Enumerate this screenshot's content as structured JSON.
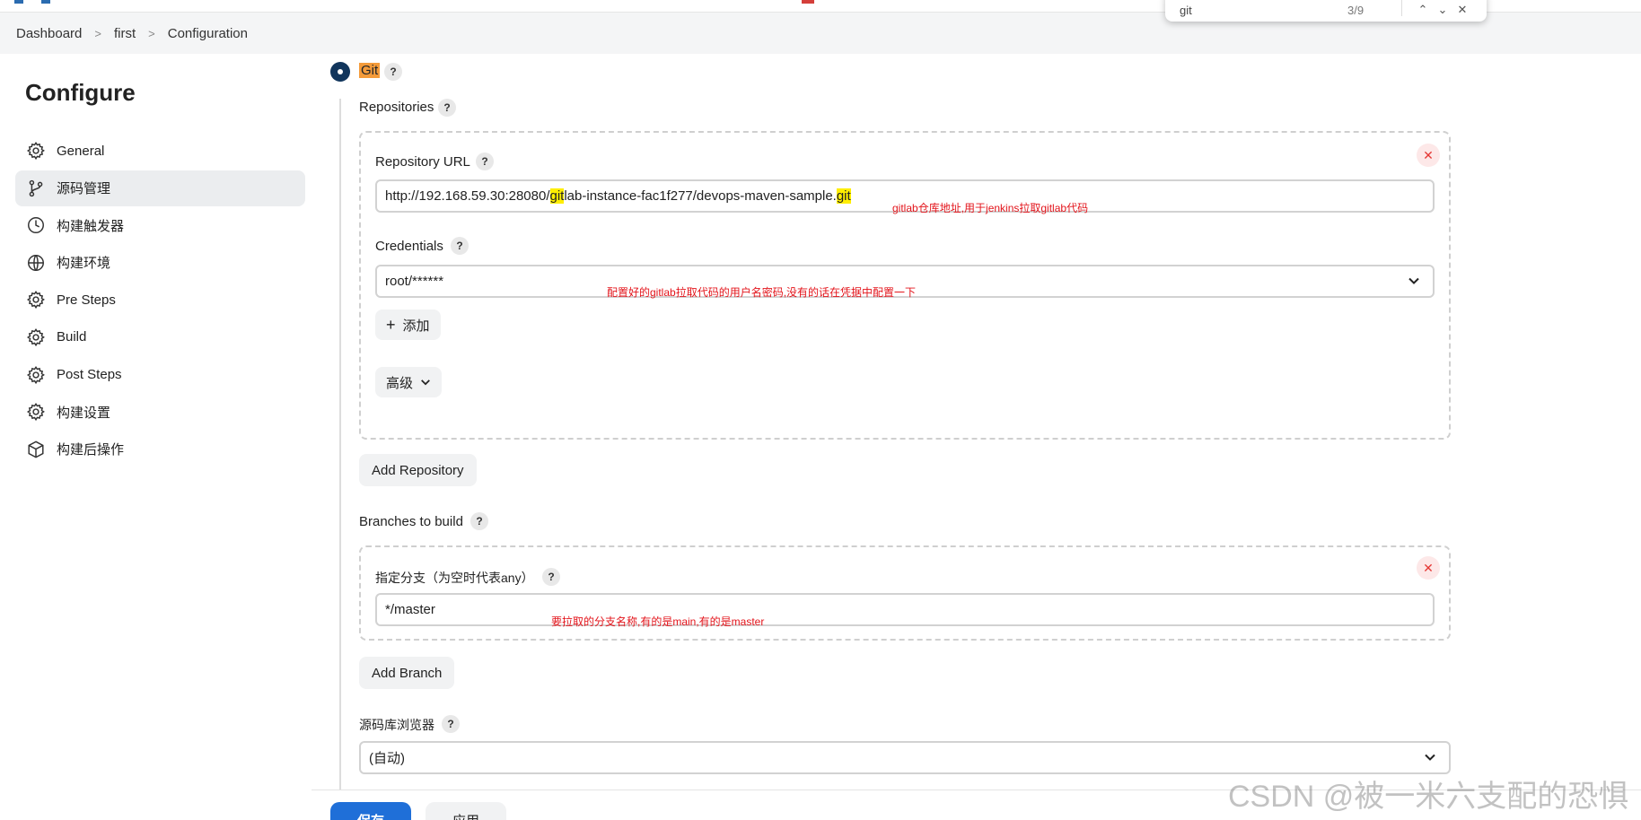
{
  "breadcrumbs": [
    "Dashboard",
    "first",
    "Configuration"
  ],
  "find_bar": {
    "query": "git",
    "count": "3/9"
  },
  "sidebar": {
    "title": "Configure",
    "items": [
      {
        "label": "General",
        "icon": "gear-icon"
      },
      {
        "label": "源码管理",
        "icon": "branch-icon"
      },
      {
        "label": "构建触发器",
        "icon": "clock-icon"
      },
      {
        "label": "构建环境",
        "icon": "globe-icon"
      },
      {
        "label": "Pre Steps",
        "icon": "gear-icon"
      },
      {
        "label": "Build",
        "icon": "gear-icon"
      },
      {
        "label": "Post Steps",
        "icon": "gear-icon"
      },
      {
        "label": "构建设置",
        "icon": "gear-icon"
      },
      {
        "label": "构建后操作",
        "icon": "cube-icon"
      }
    ],
    "active_index": 1
  },
  "scm": {
    "option_label": "Git",
    "repositories_label": "Repositories",
    "repo_url_label": "Repository URL",
    "repo_url_parts": [
      "http://192.168.59.30:28080/",
      "git",
      "lab-instance-fac1f277/devops-maven-sample.",
      "git"
    ],
    "repo_url_note": "gitlab仓库地址,用于jenkins拉取gitlab代码",
    "credentials_label": "Credentials",
    "credentials_value": "root/******",
    "credentials_note": "配置好的gitlab拉取代码的用户名密码,没有的话在凭据中配置一下",
    "add_label": "添加",
    "advanced_label": "高级",
    "add_repository_label": "Add Repository",
    "branches_label": "Branches to build",
    "branch_spec_label": "指定分支（为空时代表any）",
    "branch_value": "*/master",
    "branch_note": "要拉取的分支名称,有的是main,有的是master",
    "add_branch_label": "Add Branch",
    "browser_label": "源码库浏览器",
    "browser_value": "(自动)"
  },
  "footer": {
    "save_label": "保存",
    "apply_label": "应用"
  },
  "watermark": "CSDN @被一米六支配的恐惧",
  "colors": {
    "primary": "#1f6fd8",
    "radio": "#11355c",
    "highlight": "#ffee00",
    "annotation": "#e3141b",
    "git_tag": "#f49b3a"
  }
}
